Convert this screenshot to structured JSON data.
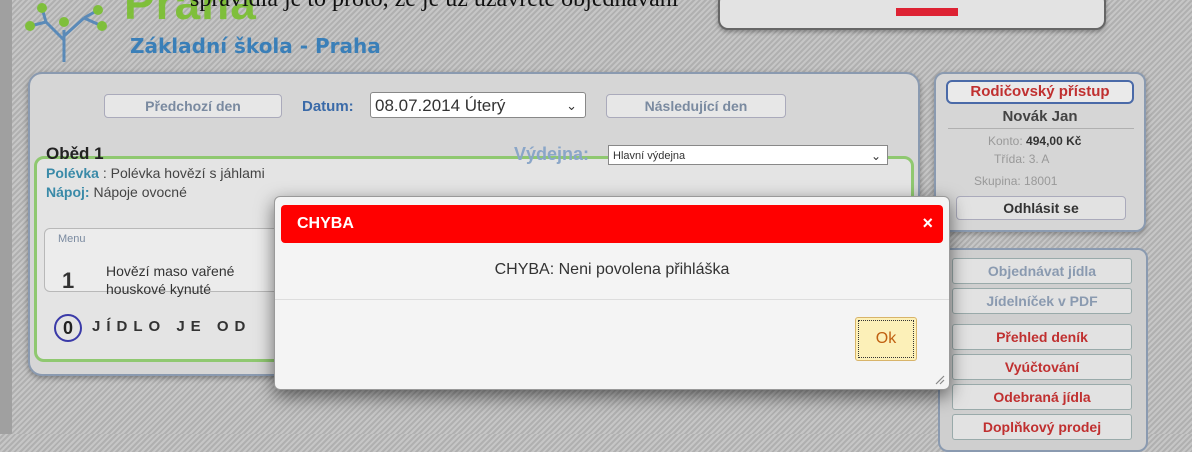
{
  "header": {
    "caption": "správidla je to proto, že je už uzavřeté objednávání",
    "brand_big": "Praha",
    "school_name": "Základní škola  -  Praha"
  },
  "nav": {
    "prev_day": "Předchozí den",
    "date_label": "Datum:",
    "date_value": "08.07.2014 Úterý",
    "next_day": "Následující den"
  },
  "meal": {
    "title": "Oběd 1",
    "soup_key": "Polévka",
    "soup_value": " : Polévka hovězí s jáhlami",
    "drink_key": "Nápoj:",
    "drink_value": " Nápoje ovocné",
    "vydejna_label": "Výdejna:",
    "vydejna_value": "Hlavní výdejna",
    "menu_header": "Menu",
    "menu_number": "1",
    "menu_text_1": "Hovězí maso vařené",
    "menu_text_2": "houskové kynuté",
    "count": "0",
    "closed_text": "JÍDLO JE OD"
  },
  "user": {
    "parent_access": "Rodičovský přístup",
    "name": "Novák Jan",
    "konto_label": "Konto:",
    "konto_value": "494,00 Kč",
    "trida_label": "Třída:",
    "trida_value": "3. A",
    "skupina_label": "Skupina:",
    "skupina_value": "18001",
    "logout": "Odhlásit se"
  },
  "side_menu": {
    "order": "Objednávat jídla",
    "pdf": "Jídelníček v PDF",
    "overview": "Přehled deník",
    "billing": "Vyúčtování",
    "taken": "Odebraná jídla",
    "extra": "Doplňkový prodej"
  },
  "modal": {
    "title": "CHYBA",
    "close": "×",
    "message": "CHYBA: Neni povolena přihláška",
    "ok": "Ok"
  },
  "colors": {
    "modal_header": "#ff0000",
    "ok_button": "#fcf0b8",
    "meal_border": "#8fc870"
  }
}
